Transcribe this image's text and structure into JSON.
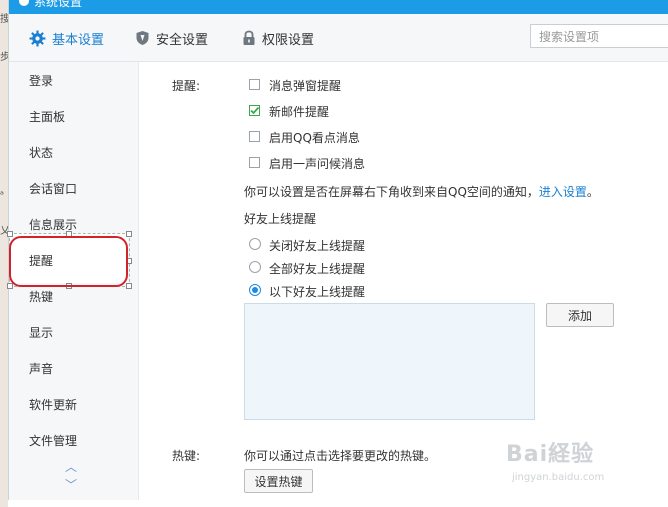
{
  "window": {
    "title": "系统设置"
  },
  "desktop": {
    "fragments": [
      "搜",
      "步",
      "ᵃ",
      "乂"
    ]
  },
  "tabs": [
    {
      "label": "基本设置",
      "icon": "gear-icon"
    },
    {
      "label": "安全设置",
      "icon": "shield-icon"
    },
    {
      "label": "权限设置",
      "icon": "lock-icon"
    }
  ],
  "search": {
    "placeholder": "搜索设置项",
    "value": ""
  },
  "sidebar": {
    "items": [
      {
        "label": "登录"
      },
      {
        "label": "主面板"
      },
      {
        "label": "状态"
      },
      {
        "label": "会话窗口"
      },
      {
        "label": "信息展示"
      },
      {
        "label": "提醒",
        "selected": true
      },
      {
        "label": "热键"
      },
      {
        "label": "显示"
      },
      {
        "label": "声音"
      },
      {
        "label": "软件更新"
      },
      {
        "label": "文件管理"
      }
    ],
    "scroll_up": "︿",
    "scroll_down": "﹀"
  },
  "reminder": {
    "section_label": "提醒:",
    "options": [
      {
        "label": "消息弹窗提醒",
        "checked": false
      },
      {
        "label": "新邮件提醒",
        "checked": true
      },
      {
        "label": "启用QQ看点消息",
        "checked": false
      },
      {
        "label": "启用一声问候消息",
        "checked": false
      }
    ],
    "qzone_note": "你可以设置是否在屏幕右下角收到来自QQ空间的通知，",
    "qzone_link": "进入设置",
    "qzone_end": "。",
    "friend_online_title": "好友上线提醒",
    "friend_online_options": [
      {
        "label": "关闭好友上线提醒",
        "selected": false
      },
      {
        "label": "全部好友上线提醒",
        "selected": false
      },
      {
        "label": "以下好友上线提醒",
        "selected": true
      }
    ],
    "add_button": "添加"
  },
  "hotkey": {
    "section_label": "热键:",
    "note": "你可以通过点击选择要更改的热键。",
    "button": "设置热键"
  },
  "watermark": {
    "big": "Bai経验",
    "small": "jingyan.baidu.com"
  },
  "colors": {
    "accent": "#1b7fd0",
    "titlebar": "#1c9be6",
    "highlight": "#d2232a",
    "check": "#3aa74c"
  }
}
